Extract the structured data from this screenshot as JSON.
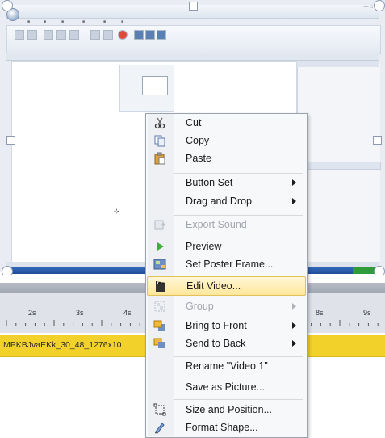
{
  "timeline": {
    "ticks": [
      "2s",
      "3s",
      "4s",
      "8s",
      "9s"
    ],
    "clip_label": "MPKBJvaEKk_30_48_1276x10"
  },
  "context_menu": {
    "items": [
      {
        "label": "Cut",
        "icon": "scissors-icon",
        "enabled": true,
        "submenu": false
      },
      {
        "label": "Copy",
        "icon": "copy-icon",
        "enabled": true,
        "submenu": false
      },
      {
        "label": "Paste",
        "icon": "paste-icon",
        "enabled": true,
        "submenu": false
      },
      {
        "label": "Button Set",
        "icon": "",
        "enabled": true,
        "submenu": true
      },
      {
        "label": "Drag and Drop",
        "icon": "",
        "enabled": true,
        "submenu": true
      },
      {
        "label": "Export Sound",
        "icon": "export-sound-icon",
        "enabled": false,
        "submenu": false
      },
      {
        "label": "Preview",
        "icon": "play-icon",
        "enabled": true,
        "submenu": false
      },
      {
        "label": "Set Poster Frame...",
        "icon": "poster-frame-icon",
        "enabled": true,
        "submenu": false
      },
      {
        "label": "Edit Video...",
        "icon": "clapperboard-icon",
        "enabled": true,
        "submenu": false,
        "highlighted": true
      },
      {
        "label": "Group",
        "icon": "group-icon",
        "enabled": false,
        "submenu": true
      },
      {
        "label": "Bring to Front",
        "icon": "bring-to-front-icon",
        "enabled": true,
        "submenu": true
      },
      {
        "label": "Send to Back",
        "icon": "send-to-back-icon",
        "enabled": true,
        "submenu": true
      },
      {
        "label": "Rename \"Video 1\"",
        "icon": "",
        "enabled": true,
        "submenu": false
      },
      {
        "label": "Save as Picture...",
        "icon": "",
        "enabled": true,
        "submenu": false
      },
      {
        "label": "Size and Position...",
        "icon": "size-position-icon",
        "enabled": true,
        "submenu": false
      },
      {
        "label": "Format Shape...",
        "icon": "format-shape-icon",
        "enabled": true,
        "submenu": false
      }
    ]
  },
  "colors": {
    "highlight": "#ffe79a",
    "clip": "#f2d22a",
    "taskbar": "#1e4c99"
  }
}
